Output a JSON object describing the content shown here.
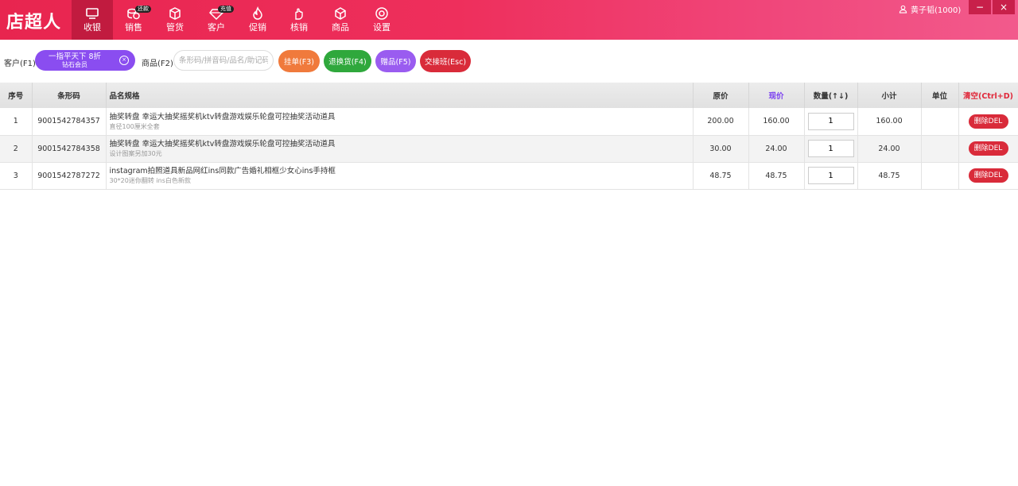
{
  "app": {
    "logo_text": "店超人"
  },
  "nav": [
    {
      "label": "收银",
      "icon": "monitor-icon",
      "active": true
    },
    {
      "label": "销售",
      "icon": "coins-icon",
      "badge": "还款"
    },
    {
      "label": "管货",
      "icon": "box-icon"
    },
    {
      "label": "客户",
      "icon": "diamond-icon",
      "badge": "充值"
    },
    {
      "label": "促销",
      "icon": "flame-icon"
    },
    {
      "label": "核销",
      "icon": "hand-icon"
    },
    {
      "label": "商品",
      "icon": "cube-icon"
    },
    {
      "label": "设置",
      "icon": "settings-icon"
    }
  ],
  "user": {
    "name": "黄子韬(1000)"
  },
  "window": {
    "minimize": "−",
    "close": "×"
  },
  "toolbar": {
    "customer_label": "客户(F1)",
    "customer_name": "一指平天下 8折",
    "customer_level": "钻石会员",
    "product_label": "商品(F2)",
    "product_placeholder": "条形码/拼音码/品名/助记码",
    "btn_hold": "挂单(F3)",
    "btn_return": "退换货(F4)",
    "btn_gift": "赠品(F5)",
    "btn_handover": "交接班(Esc)"
  },
  "colors": {
    "hold": "#f07a3c",
    "return": "#2fa83c",
    "gift": "#9a5cf0",
    "handover": "#d92b3a"
  },
  "table": {
    "headers": {
      "index": "序号",
      "barcode": "条形码",
      "name": "品名规格",
      "orig_price": "原价",
      "cur_price": "现价",
      "qty": "数量(↑↓)",
      "subtotal": "小计",
      "unit": "单位",
      "clear": "清空(Ctrl+D)"
    },
    "rows": [
      {
        "index": "1",
        "barcode": "9001542784357",
        "name": "抽奖转盘 幸运大抽奖摇奖机ktv转盘游戏娱乐轮盘可控抽奖活动道具",
        "spec": "直径100厘米全套",
        "orig_price": "200.00",
        "cur_price": "160.00",
        "qty": "1",
        "subtotal": "160.00",
        "unit": "",
        "delete_label": "删除DEL"
      },
      {
        "index": "2",
        "barcode": "9001542784358",
        "name": "抽奖转盘 幸运大抽奖摇奖机ktv转盘游戏娱乐轮盘可控抽奖活动道具",
        "spec": "设计图案另加30元",
        "orig_price": "30.00",
        "cur_price": "24.00",
        "qty": "1",
        "subtotal": "24.00",
        "unit": "",
        "delete_label": "删除DEL"
      },
      {
        "index": "3",
        "barcode": "9001542787272",
        "name": "instagram拍照道具新品网红ins同款广告婚礼相框少女心ins手持框",
        "spec": "30*20迷你翻转 ins白色新款",
        "orig_price": "48.75",
        "cur_price": "48.75",
        "qty": "1",
        "subtotal": "48.75",
        "unit": "",
        "delete_label": "删除DEL"
      }
    ]
  }
}
